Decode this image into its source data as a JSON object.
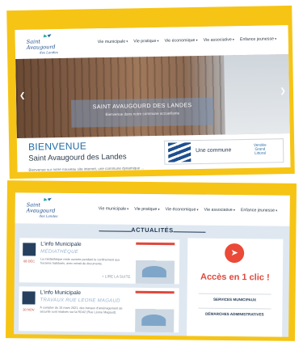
{
  "top": {
    "logo": {
      "line1": "Saint",
      "line2": "Avaugourd",
      "line3": "des Landes"
    },
    "nav": [
      "Vie municipale",
      "Vie pratique",
      "Vie économique",
      "Vie associative",
      "Enfance jeunesse"
    ],
    "hero": {
      "banner_title": "SAINT AVAUGOURD DES LANDES",
      "banner_subtitle": "Bienvenue dans notre commune accueillante"
    },
    "welcome": {
      "heading": "BIENVENUE",
      "subheading": "Saint Avaugourd des Landes",
      "intro": "Bienvenue sur notre nouveau site internet, une commune dynamique ..."
    },
    "badge": {
      "text": "Une commune",
      "partner_line1": "Vendée",
      "partner_line2": "Grand",
      "partner_line3": "Littoral"
    }
  },
  "bottom": {
    "nav": [
      "Vie municipale",
      "Vie pratique",
      "Vie économique",
      "Vie associative",
      "Enfance jeunesse"
    ],
    "section_title": "ACTUALITÉS",
    "cards": [
      {
        "title": "L'info Municipale",
        "subtitle": "MÉDIATHÈQUE",
        "date": "08 DEC",
        "desc": "La médiathèque reste ouverte pendant le confinement aux horaires habituels, avec retrait de documents.",
        "more": "+ LIRE LA SUITE"
      },
      {
        "title": "L'info Municipale",
        "subtitle": "TRAVAUX RUE LÉONE MAGAUD",
        "date": "30 NOV",
        "desc": "À compter du 15 mars 2021, des travaux d'aménagement de sécurité sont réalisés sur la RD42 (Rue Léone Magaud).",
        "more": ""
      }
    ],
    "quick_access": {
      "title": "Accès en 1 clic !",
      "links": [
        "SERVICES MUNICIPAUX",
        "DÉMARCHES ADMINISTRATIVES"
      ]
    }
  }
}
